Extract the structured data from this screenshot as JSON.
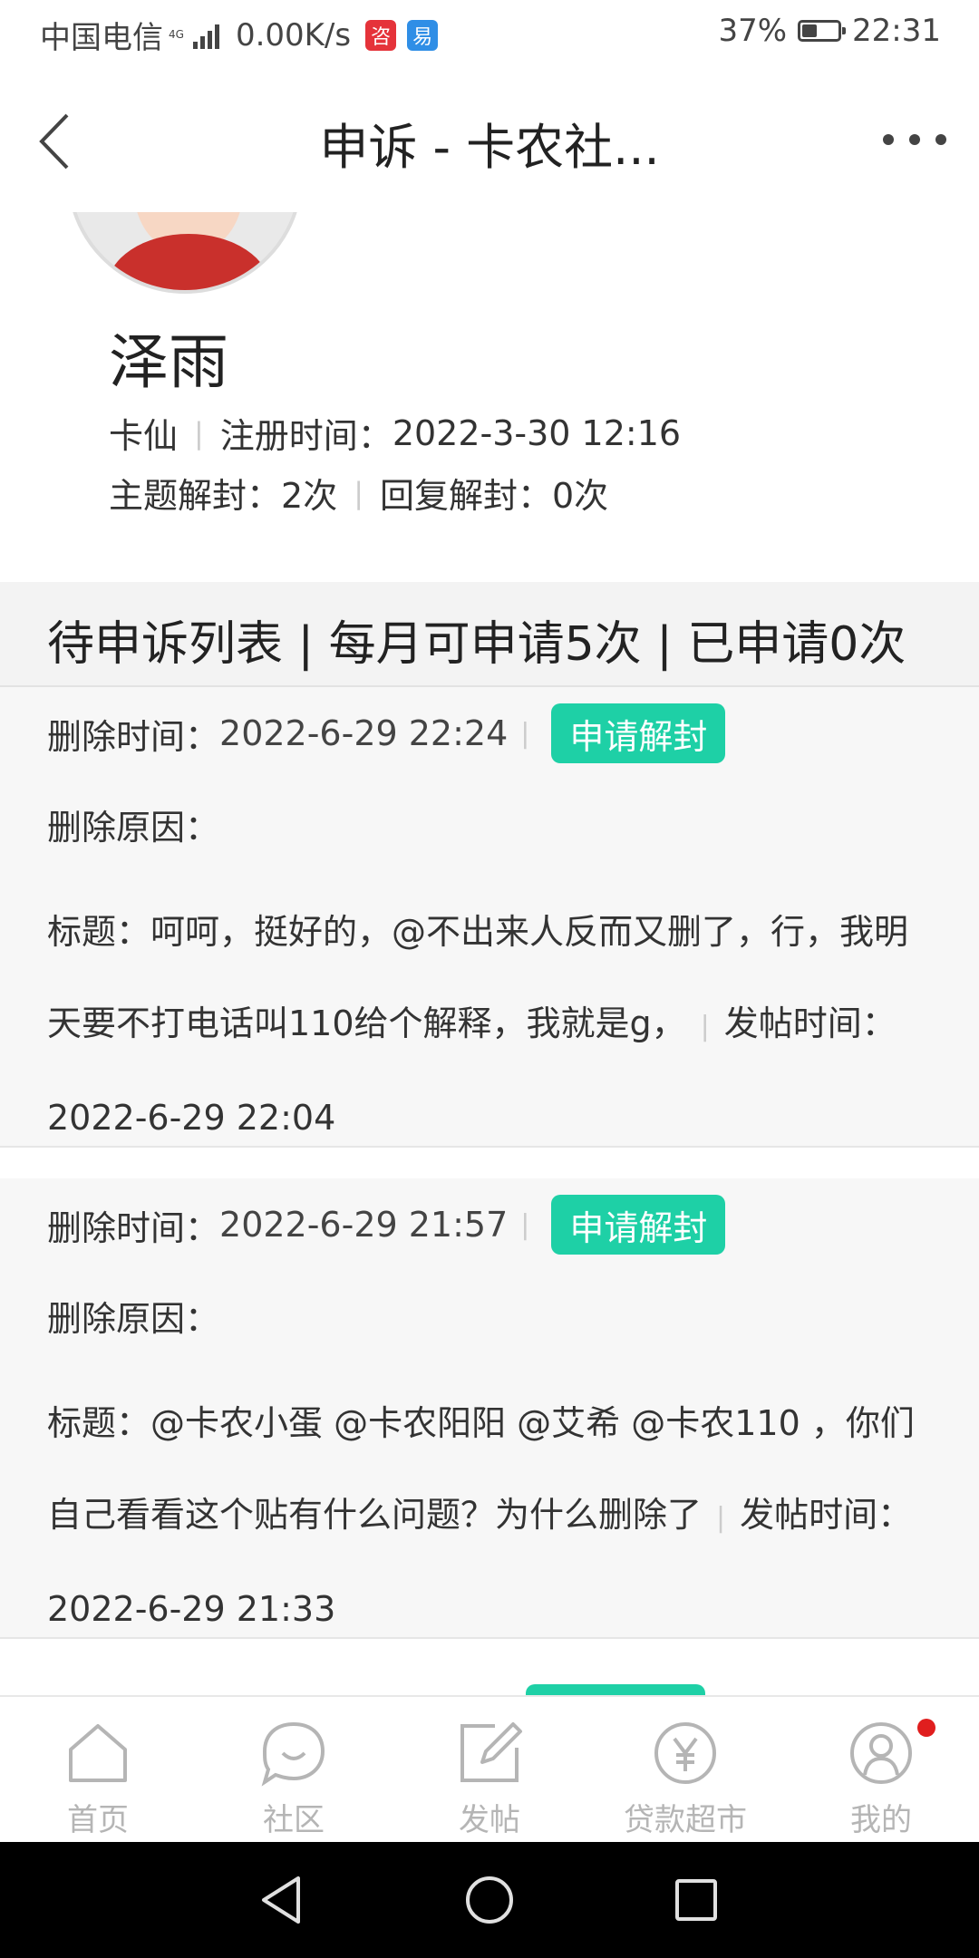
{
  "status_bar": {
    "carrier": "中国电信",
    "network": "4G",
    "speed": "0.00K/s",
    "app1_glyph": "咨",
    "app2_glyph": "易",
    "battery_percent_text": "37%",
    "battery_level": 0.37,
    "time": "22:31"
  },
  "nav": {
    "title": "申诉 - 卡农社..."
  },
  "profile": {
    "name": "泽雨",
    "level": "卡仙",
    "register_label": "注册时间：",
    "register_time": "2022-3-30 12:16",
    "topic_unblock_label": "主题解封：",
    "topic_unblock_count": "2次",
    "reply_unblock_label": "回复解封：",
    "reply_unblock_count": "0次"
  },
  "list_header": "待申诉列表 | 每月可申请5次 | 已申请0次",
  "appeals": [
    {
      "delete_time_label": "删除时间：",
      "delete_time": "2022-6-29 22:24",
      "button": "申请解封",
      "reason_label": "删除原因：",
      "title_label": "标题：",
      "title": "呵呵，挺好的，@不出来人反而又删了，行，我明天要不打电话叫110给个解释，我就是g，",
      "post_time_label": "发帖时间：",
      "post_time": "2022-6-29 22:04"
    },
    {
      "delete_time_label": "删除时间：",
      "delete_time": "2022-6-29 21:57",
      "button": "申请解封",
      "reason_label": "删除原因：",
      "title_label": "标题：",
      "title": "@卡农小蛋 @卡农阳阳 @艾希 @卡农110 ，你们自己看看这个贴有什么问题？为什么删除了",
      "post_time_label": "发帖时间：",
      "post_time": "2022-6-29 21:33"
    }
  ],
  "tabs": [
    {
      "label": "首页",
      "icon": "home-icon"
    },
    {
      "label": "社区",
      "icon": "chat-bubble-icon"
    },
    {
      "label": "发帖",
      "icon": "edit-post-icon"
    },
    {
      "label": "贷款超市",
      "icon": "yuan-icon"
    },
    {
      "label": "我的",
      "icon": "user-icon"
    }
  ],
  "colors": {
    "accent": "#1ed0a6",
    "notification_dot": "#e01e1e",
    "tab_inactive": "#b5b5b5"
  }
}
